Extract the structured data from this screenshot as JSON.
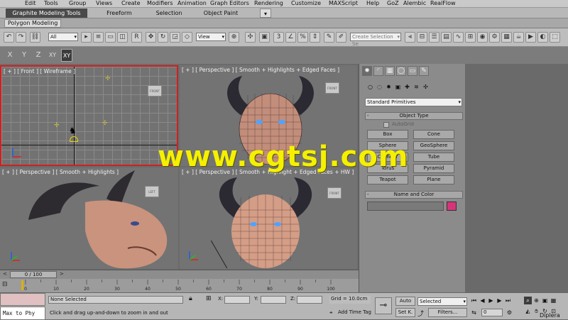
{
  "menubar": [
    "Edit",
    "Tools",
    "Group",
    "Views",
    "Create",
    "Modifiers",
    "Animation",
    "Graph Editors",
    "Rendering",
    "Customize",
    "MAXScript",
    "Help",
    "GoZ",
    "Alembic",
    "RealFlow"
  ],
  "ribbon": {
    "tabs": [
      "Graphite Modeling Tools",
      "Freeform",
      "Selection",
      "Object Paint"
    ],
    "active_tab": "Graphite Modeling Tools",
    "sub_tab": "Polygon Modeling"
  },
  "toolbar": {
    "filter_value": "All",
    "ref_coord_value": "View",
    "num_label": "3",
    "selection_set_placeholder": "Create Selection Se"
  },
  "axis_constraints": [
    "X",
    "Y",
    "Z",
    "XY",
    "XY"
  ],
  "viewports": {
    "top_left": "[ + ] [ Front ] [ Wireframe ]",
    "top_right": "[ + ] [ Perspective ] [ Smooth + Highlights + Edged Faces ]",
    "bottom_left": "[ + ] [ Perspective ] [ Smooth + Highlights ]",
    "bottom_right": "[ + ] [ Perspective ] [ Smooth + Highlight + Edged Faces + HW ]"
  },
  "command_panel": {
    "category_value": "Standard Primitives",
    "object_type_title": "Object Type",
    "autogrid_label": "AutoGrid",
    "buttons": [
      "Box",
      "Cone",
      "Sphere",
      "GeoSphere",
      "Cylinder",
      "Tube",
      "Torus",
      "Pyramid",
      "Teapot",
      "Plane"
    ],
    "name_color_title": "Name and Color",
    "object_color": "#d6347a"
  },
  "timeline": {
    "frame_readout": "0 / 100",
    "ticks": [
      "0",
      "10",
      "20",
      "30",
      "40",
      "50",
      "60",
      "70",
      "80",
      "90",
      "100"
    ]
  },
  "status": {
    "maxscript_value": "Max to Phy",
    "selection_status": "None Selected",
    "prompt": "Click and drag up-and-down to zoom in and out",
    "x_label": "X:",
    "y_label": "Y:",
    "z_label": "Z:",
    "grid": "Grid = 10.0cm",
    "add_time_tag": "Add Time Tag",
    "auto_label": "Auto",
    "setk_label": "Set K.",
    "key_filter_value": "Selected",
    "filters_label": "Filters...",
    "current_frame": "0",
    "logo_text": "Diplera"
  },
  "watermark": "www.cgtsj.com",
  "colors": {
    "accent_red": "#d21f1f",
    "watermark_yellow": "#f5f000"
  }
}
